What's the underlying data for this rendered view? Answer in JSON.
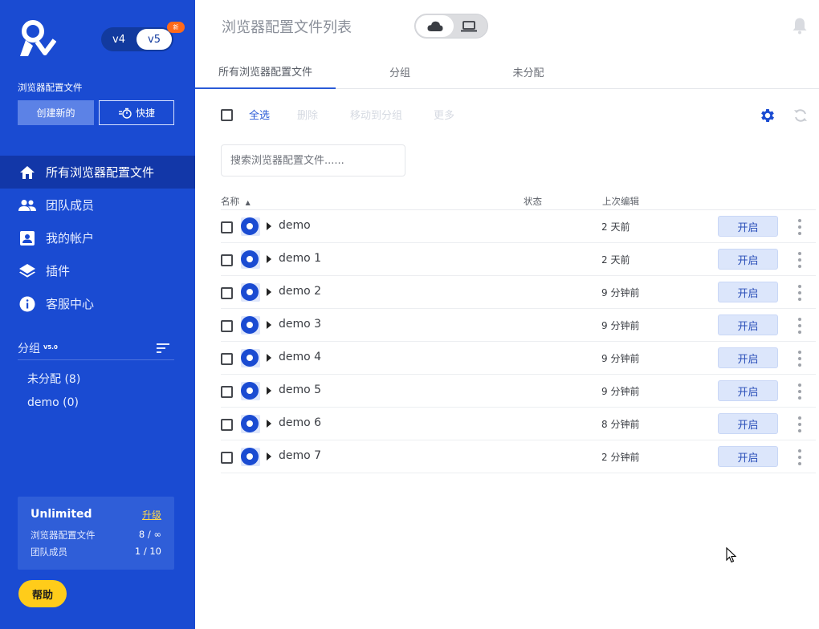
{
  "sidebar": {
    "versions": [
      "v4",
      "v5"
    ],
    "active_version": "v5",
    "new_badge": "新",
    "section_title": "浏览器配置文件",
    "create_label": "创建新的",
    "quick_label": "快捷",
    "nav": [
      {
        "label": "所有浏览器配置文件",
        "icon": "home-icon",
        "active": true
      },
      {
        "label": "团队成员",
        "icon": "team-icon",
        "active": false
      },
      {
        "label": "我的帐户",
        "icon": "account-icon",
        "active": false
      },
      {
        "label": "插件",
        "icon": "layers-icon",
        "active": false
      },
      {
        "label": "客服中心",
        "icon": "info-icon",
        "active": false
      }
    ],
    "groups": {
      "title": "分组",
      "version_tag": "V5.0",
      "items": [
        {
          "label": "未分配 (8)"
        },
        {
          "label": "demo (0)"
        }
      ]
    },
    "plan": {
      "name": "Unlimited",
      "upgrade": "升级",
      "rows": [
        {
          "label": "浏览器配置文件",
          "value": "8 / ∞"
        },
        {
          "label": "团队成员",
          "value": "1 / 10"
        }
      ]
    },
    "help_label": "帮助"
  },
  "header": {
    "title": "浏览器配置文件列表"
  },
  "tabs": [
    {
      "label": "所有浏览器配置文件",
      "active": true
    },
    {
      "label": "分组",
      "active": false
    },
    {
      "label": "未分配",
      "active": false
    }
  ],
  "toolbar": {
    "select_all": "全选",
    "delete": "删除",
    "move_to_group": "移动到分组",
    "more": "更多"
  },
  "search": {
    "placeholder": "搜索浏览器配置文件......"
  },
  "table": {
    "columns": [
      "名称",
      "状态",
      "上次编辑"
    ],
    "sort_indicator": "▲",
    "open_label": "开启",
    "rows": [
      {
        "name": "demo",
        "status": "",
        "edited": "2 天前"
      },
      {
        "name": "demo 1",
        "status": "",
        "edited": "2 天前"
      },
      {
        "name": "demo 2",
        "status": "",
        "edited": "9 分钟前"
      },
      {
        "name": "demo 3",
        "status": "",
        "edited": "9 分钟前"
      },
      {
        "name": "demo 4",
        "status": "",
        "edited": "9 分钟前"
      },
      {
        "name": "demo 5",
        "status": "",
        "edited": "9 分钟前"
      },
      {
        "name": "demo 6",
        "status": "",
        "edited": "8 分钟前"
      },
      {
        "name": "demo 7",
        "status": "",
        "edited": "2 分钟前"
      }
    ]
  },
  "colors": {
    "sidebar_bg": "#1a4bd2",
    "accent": "#2a5bd7",
    "help_button": "#ffcc1a",
    "upgrade_link": "#ffd84a"
  }
}
